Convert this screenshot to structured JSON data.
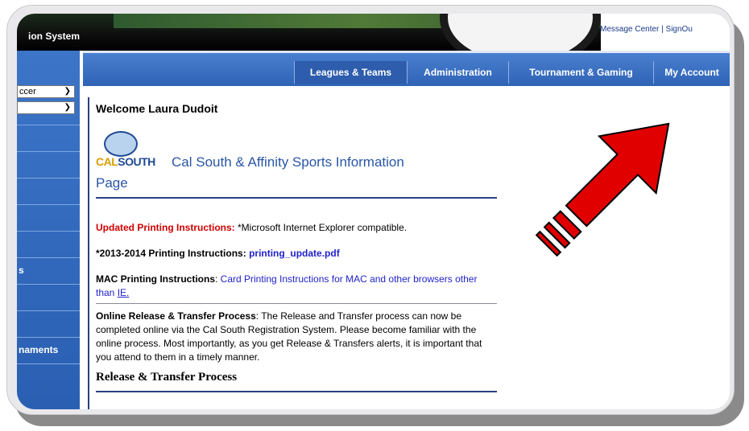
{
  "banner": {
    "title": "ion System",
    "links": "Message Center | SignOu"
  },
  "sidebar": {
    "select1": "ccer",
    "select2": "",
    "items": [
      "",
      "",
      "",
      "",
      "",
      "s",
      "",
      "",
      "naments",
      ""
    ]
  },
  "nav": {
    "tabs": [
      {
        "label": "Leagues & Teams",
        "active": true
      },
      {
        "label": "Administration",
        "active": false
      },
      {
        "label": "Tournament & Gaming",
        "active": false
      },
      {
        "label": "My Account",
        "active": false
      }
    ]
  },
  "content": {
    "welcome": "Welcome Laura Dudoit",
    "logo_cal": "CAL",
    "logo_south": "SOUTH",
    "heading_line1": "Cal South & Affinity Sports Information",
    "heading_line2": "Page",
    "updated_label": "Updated Printing Instructions:",
    "updated_text": " *Microsoft Internet Explorer compatible.",
    "printing_2013_label": "*2013-2014 Printing Instructions: ",
    "printing_2013_link": "printing_update.pdf",
    "mac_label": "MAC Printing Instructions",
    "mac_colon": ": ",
    "mac_link": "Card Printing Instructions for MAC and other browsers other than ",
    "mac_link_ie": "IE.",
    "release_label": "Online Release & Transfer Process",
    "release_text": ":  The Release and Transfer process can now be completed online via the Cal South Registration System. Please become familiar with the online process. Most importantly, as you get Release & Transfers alerts, it is important that you attend to them in a timely manner.",
    "release_title": "Release & Transfer Process"
  },
  "colors": {
    "nav_blue": "#2f63b5",
    "heading_blue": "#2a56a6",
    "alert_red": "#d00000",
    "arrow_red": "#e00000"
  },
  "icons": {
    "arrow": "red-arrow-icon",
    "chevron": "chevron-down-icon"
  }
}
